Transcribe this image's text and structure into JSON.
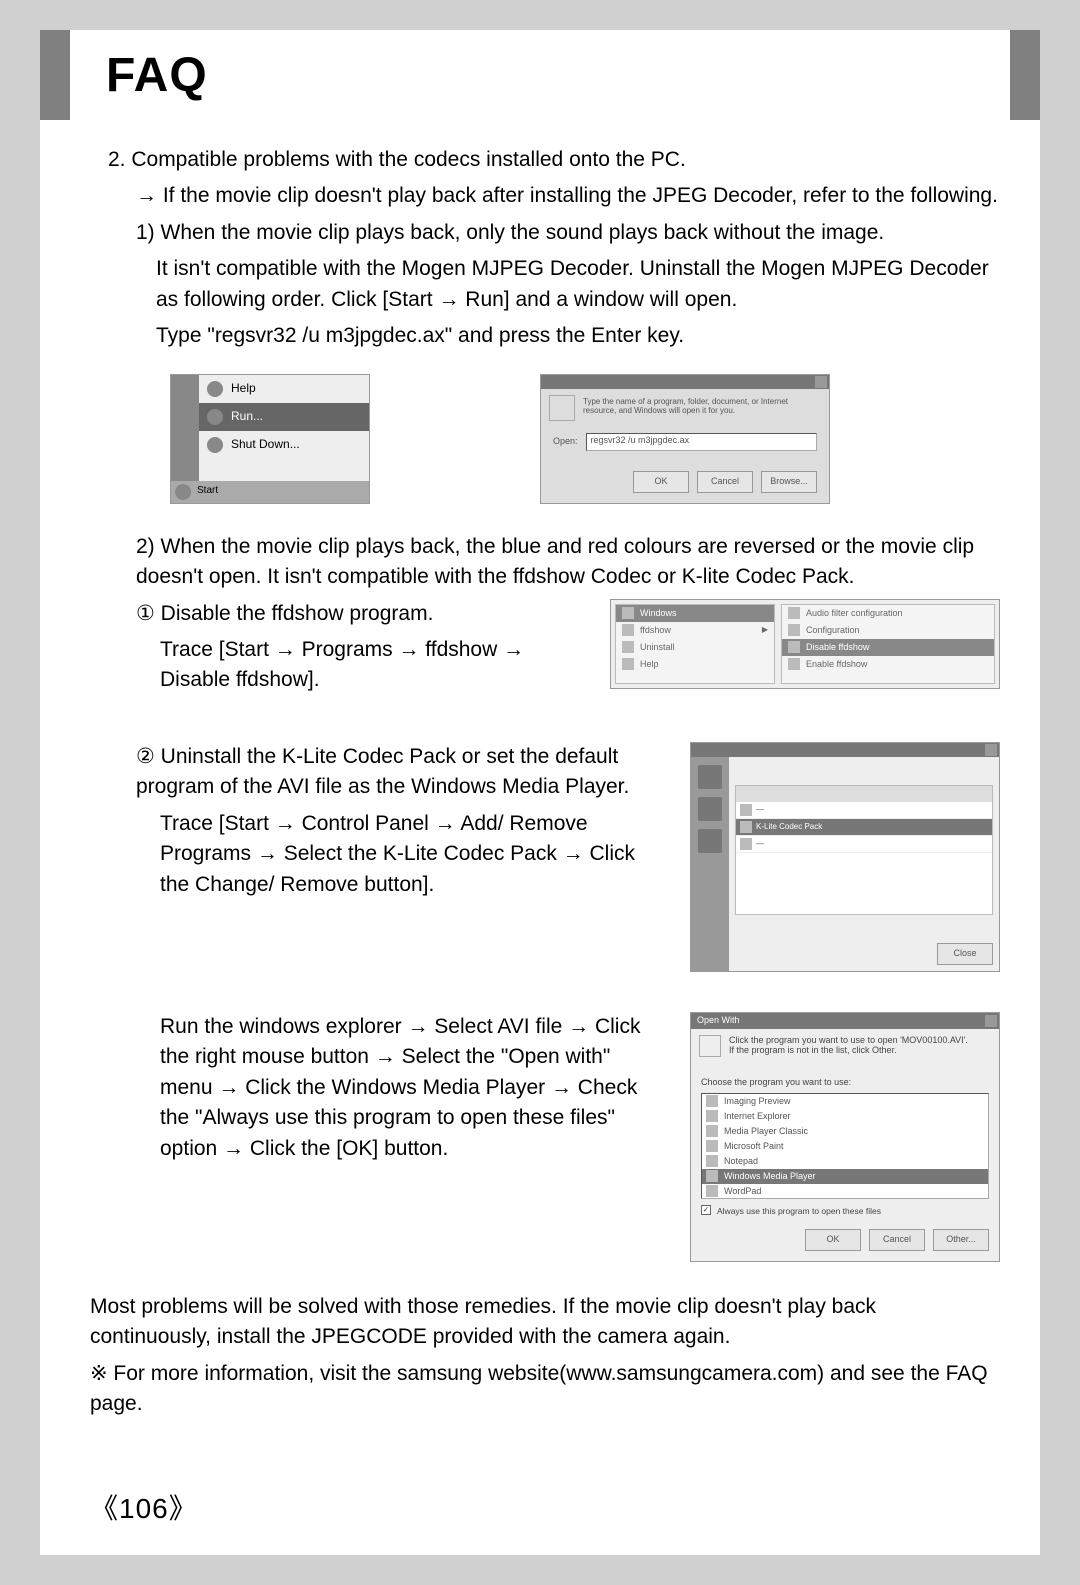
{
  "header": {
    "title": "FAQ"
  },
  "items": {
    "n2": "2. Compatible problems with the codecs installed onto the PC.",
    "n2_arrow": "→ If the movie clip doesn't play back after installing the JPEG Decoder, refer to the following.",
    "n2_1_a": "1) When the movie clip plays back, only the sound plays back without the image.",
    "n2_1_b": "It isn't compatible with the Mogen MJPEG Decoder. Uninstall the Mogen MJPEG Decoder as following order. Click [Start → Run] and a window will open.",
    "n2_1_c": "Type \"regsvr32 /u m3jpgdec.ax\" and press the Enter key.",
    "n2_2_a": "2) When the movie clip plays back, the blue and red colours are reversed or the movie clip doesn't open. It isn't compatible with the ffdshow Codec or K-lite Codec Pack.",
    "circ1_a": "① Disable the ffdshow program.",
    "circ1_b": "Trace [Start → Programs → ffdshow  →  Disable ffdshow].",
    "circ2_a": "② Uninstall the K-Lite Codec Pack or set the default program of the AVI file as the Windows Media Player.",
    "circ2_b": "Trace [Start → Control Panel → Add/ Remove Programs → Select the K-Lite Codec Pack → Click the Change/ Remove button].",
    "circ2_c": "Run the windows explorer → Select AVI file → Click the right mouse button → Select the \"Open with\" menu → Click the Windows Media Player → Check the \"Always use this program to open these files\" option → Click the [OK] button.",
    "final": "Most problems will be solved with those remedies. If the movie clip doesn't play back continuously, install the JPEGCODE provided with the camera again.",
    "note": "※ For more information, visit the samsung website(www.samsungcamera.com) and see the FAQ page."
  },
  "start_menu": {
    "item1": "Help",
    "item2": "Run...",
    "item3": "Shut Down...",
    "tray": "Start"
  },
  "run_dialog": {
    "desc": "Type the name of a program, folder, document, or Internet resource, and Windows will open it for you.",
    "open_label": "Open:",
    "input_value": "regsvr32 /u m3jpgdec.ax",
    "btn_ok": "OK",
    "btn_cancel": "Cancel",
    "btn_browse": "Browse..."
  },
  "ffdshow_menu": {
    "left_header": "Windows",
    "left_items": [
      "ffdshow",
      "Uninstall",
      "Help"
    ],
    "right_items": [
      "Audio filter configuration",
      "Configuration",
      "Disable ffdshow",
      "Enable ffdshow"
    ],
    "right_selected_index": 2
  },
  "add_remove": {
    "row_sel": "K-Lite Codec Pack",
    "btn_close": "Close"
  },
  "open_with": {
    "title": "Open With",
    "desc1": "Click the program you want to use to open 'MOV00100.AVI'.",
    "desc2": "If the program is not in the list, click Other.",
    "label": "Choose the program you want to use:",
    "items": [
      "Imaging Preview",
      "Internet Explorer",
      "Media Player Classic",
      "Microsoft Paint",
      "Notepad",
      "Windows Media Player",
      "WordPad"
    ],
    "selected_index": 5,
    "checkbox": "Always use this program to open these files",
    "btn_ok": "OK",
    "btn_cancel": "Cancel",
    "btn_other": "Other..."
  },
  "page_number": "《106》"
}
